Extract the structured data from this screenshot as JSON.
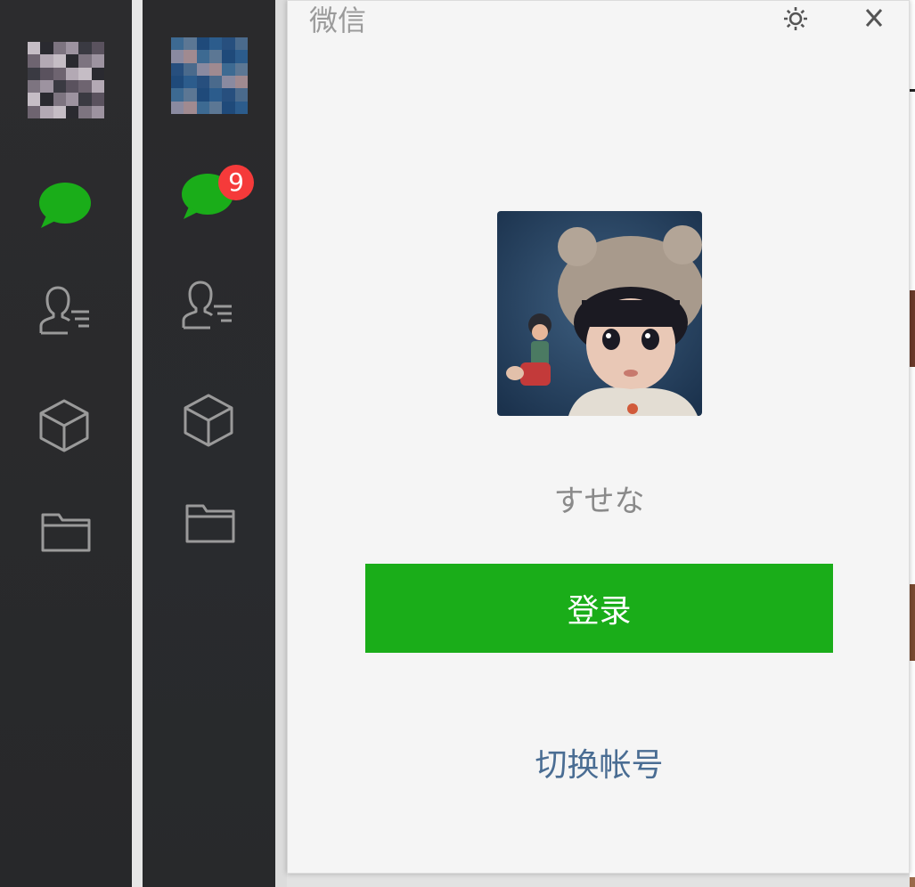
{
  "window": {
    "title": "微信",
    "settings_icon": "gear-icon",
    "close_icon": "close-icon"
  },
  "sidebars": [
    {
      "avatar": "pixelated-avatar-icon",
      "items": [
        {
          "icon": "chat-bubble-icon",
          "active": true
        },
        {
          "icon": "contacts-icon",
          "active": false
        },
        {
          "icon": "cube-icon",
          "active": false
        },
        {
          "icon": "folder-icon",
          "active": false
        }
      ]
    },
    {
      "avatar": "pixelated-avatar-icon",
      "items": [
        {
          "icon": "chat-bubble-icon",
          "active": true,
          "badge": "9"
        },
        {
          "icon": "contacts-icon",
          "active": false
        },
        {
          "icon": "cube-icon",
          "active": false
        },
        {
          "icon": "folder-icon",
          "active": false
        }
      ]
    }
  ],
  "login": {
    "avatar": "doll-avatar-photo",
    "username": "すせな",
    "login_label": "登录",
    "switch_account_label": "切换帐号"
  },
  "colors": {
    "sidebar_bg": "#2b2b2d",
    "active_icon": "#1aad19",
    "inactive_icon": "#9a9a9a",
    "badge": "#f53a3a",
    "login_button": "#1aad19",
    "link": "#4a6d93",
    "panel_bg": "#f5f5f5"
  }
}
